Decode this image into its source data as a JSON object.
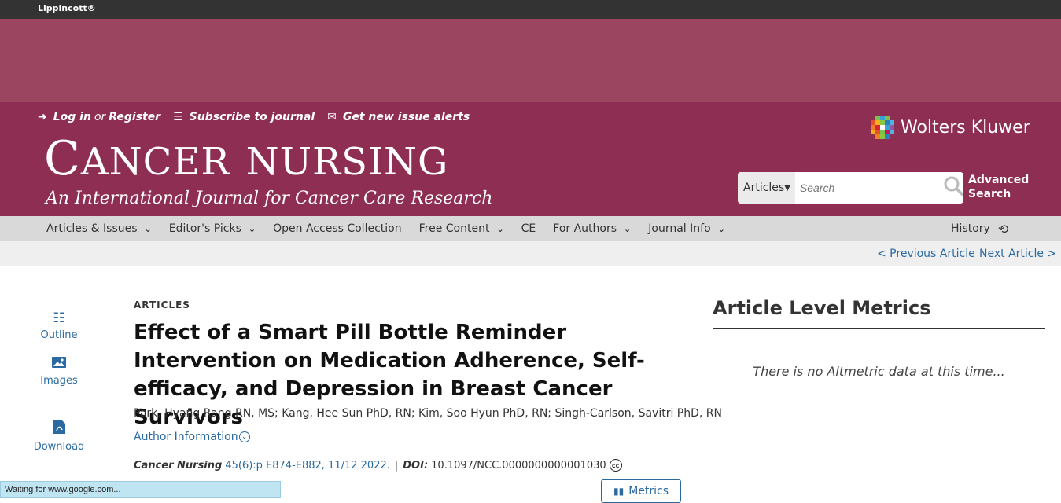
{
  "topbar": {
    "brand": "Lippincott®"
  },
  "header": {
    "links": {
      "login": "Log in",
      "or": "or",
      "register": "Register",
      "subscribe": "Subscribe to journal",
      "alerts": "Get new issue alerts"
    },
    "journal_title_first": "C",
    "journal_title_rest": "ANCER",
    "journal_title_second_first": "N",
    "journal_title_second_rest": "URSING",
    "journal_subtitle": "An International Journal for Cancer Care Research",
    "publisher": "Wolters Kluwer",
    "search": {
      "scope": "Articles",
      "placeholder": "Search",
      "advanced_line1": "Advanced",
      "advanced_line2": "Search"
    }
  },
  "nav": {
    "items": [
      {
        "label": "Articles & Issues",
        "dropdown": true
      },
      {
        "label": "Editor's Picks",
        "dropdown": true
      },
      {
        "label": "Open Access Collection",
        "dropdown": false
      },
      {
        "label": "Free Content",
        "dropdown": true
      },
      {
        "label": "CE",
        "dropdown": false
      },
      {
        "label": "For Authors",
        "dropdown": true
      },
      {
        "label": "Journal Info",
        "dropdown": true
      }
    ],
    "history": "History"
  },
  "subnav": {
    "prev": "< Previous Article",
    "next": "Next Article >"
  },
  "sidebar": {
    "outline": "Outline",
    "images": "Images",
    "download": "Download"
  },
  "article": {
    "category": "ARTICLES",
    "title": "Effect of a Smart Pill Bottle Reminder Intervention on Medication Adherence, Self-efficacy, and Depression in Breast Cancer Survivors",
    "authors": "Park, Hyang Rang RN, MS; Kang, Hee Sun PhD, RN; Kim, Soo Hyun PhD, RN; Singh-Carlson, Savitri PhD, RN",
    "author_info": "Author Information",
    "journal": "Cancer Nursing",
    "volume": "45(6):p E874-E882, 11/12 2022.",
    "doi_label": "DOI:",
    "doi": "10.1097/NCC.0000000000001030",
    "metrics_button": "Metrics"
  },
  "metrics_panel": {
    "title": "Article Level Metrics",
    "message": "There is no Altmetric data at this time..."
  },
  "statusbar": {
    "text": "Waiting for www.google.com..."
  },
  "colors": {
    "header": "#8d2e52",
    "adband": "#9b4560",
    "link": "#2a6aa0",
    "nav": "#d9d9d9"
  }
}
